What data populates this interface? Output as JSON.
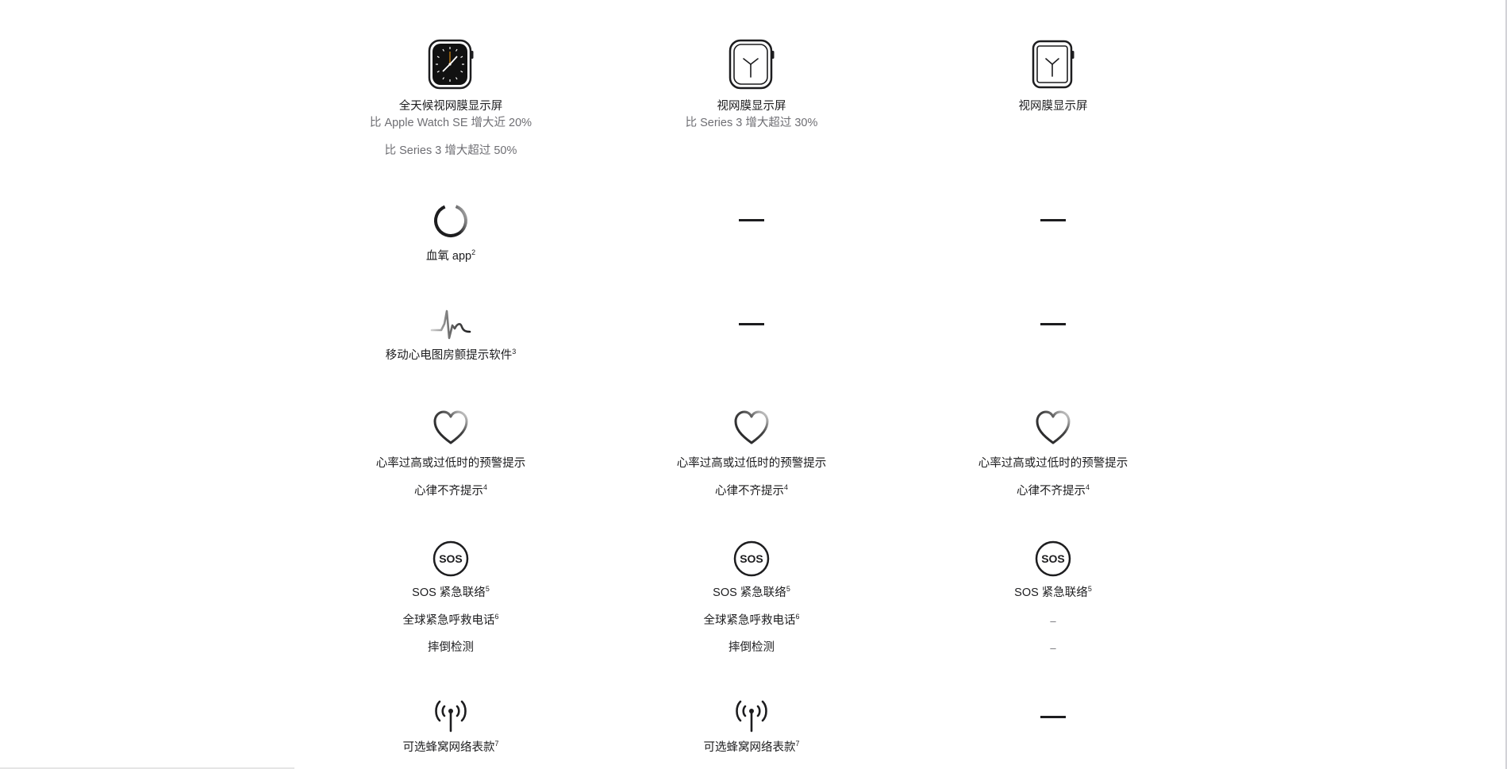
{
  "columns": [
    {
      "display": {
        "icon": "watch-always-on-icon",
        "lines": [
          "全天候视网膜显示屏",
          "比 Apple Watch SE 增大近 20%"
        ],
        "extra": "比 Series 3 增大超过 50%"
      },
      "blood_oxygen": {
        "icon": "blood-oxygen-icon",
        "label": "血氧 app",
        "note": "2"
      },
      "ecg": {
        "icon": "ecg-icon",
        "label": "移动心电图房颤提示软件",
        "note": "3"
      },
      "heart": {
        "icon": "heart-icon",
        "line1": "心率过高或过低时的预警提示",
        "line2": "心律不齐提示",
        "note": "4"
      },
      "safety": {
        "icon": "sos-icon",
        "sos_label": "SOS 紧急联络",
        "sos_note": "5",
        "intl_label": "全球紧急呼救电话",
        "intl_note": "6",
        "fall_label": "摔倒检测"
      },
      "cellular": {
        "icon": "cellular-antenna-icon",
        "label": "可选蜂窝网络表款",
        "note": "7"
      }
    },
    {
      "display": {
        "icon": "watch-retina-icon",
        "lines": [
          "视网膜显示屏",
          "比 Series 3 增大超过 30%"
        ]
      },
      "blood_oxygen": {
        "dash": "—"
      },
      "ecg": {
        "dash": "—"
      },
      "heart": {
        "icon": "heart-icon",
        "line1": "心率过高或过低时的预警提示",
        "line2": "心律不齐提示",
        "note": "4"
      },
      "safety": {
        "icon": "sos-icon",
        "sos_label": "SOS 紧急联络",
        "sos_note": "5",
        "intl_label": "全球紧急呼救电话",
        "intl_note": "6",
        "fall_label": "摔倒检测"
      },
      "cellular": {
        "icon": "cellular-antenna-icon",
        "label": "可选蜂窝网络表款",
        "note": "7"
      }
    },
    {
      "display": {
        "icon": "watch-retina-small-icon",
        "lines": [
          "视网膜显示屏"
        ]
      },
      "blood_oxygen": {
        "dash": "—"
      },
      "ecg": {
        "dash": "—"
      },
      "heart": {
        "icon": "heart-icon",
        "line1": "心率过高或过低时的预警提示",
        "line2": "心律不齐提示",
        "note": "4"
      },
      "safety": {
        "icon": "sos-icon",
        "sos_label": "SOS 紧急联络",
        "sos_note": "5",
        "intl_label": "–",
        "fall_label": "–"
      },
      "cellular": {
        "dash": "—"
      }
    }
  ],
  "sos_icon_text": "SOS"
}
